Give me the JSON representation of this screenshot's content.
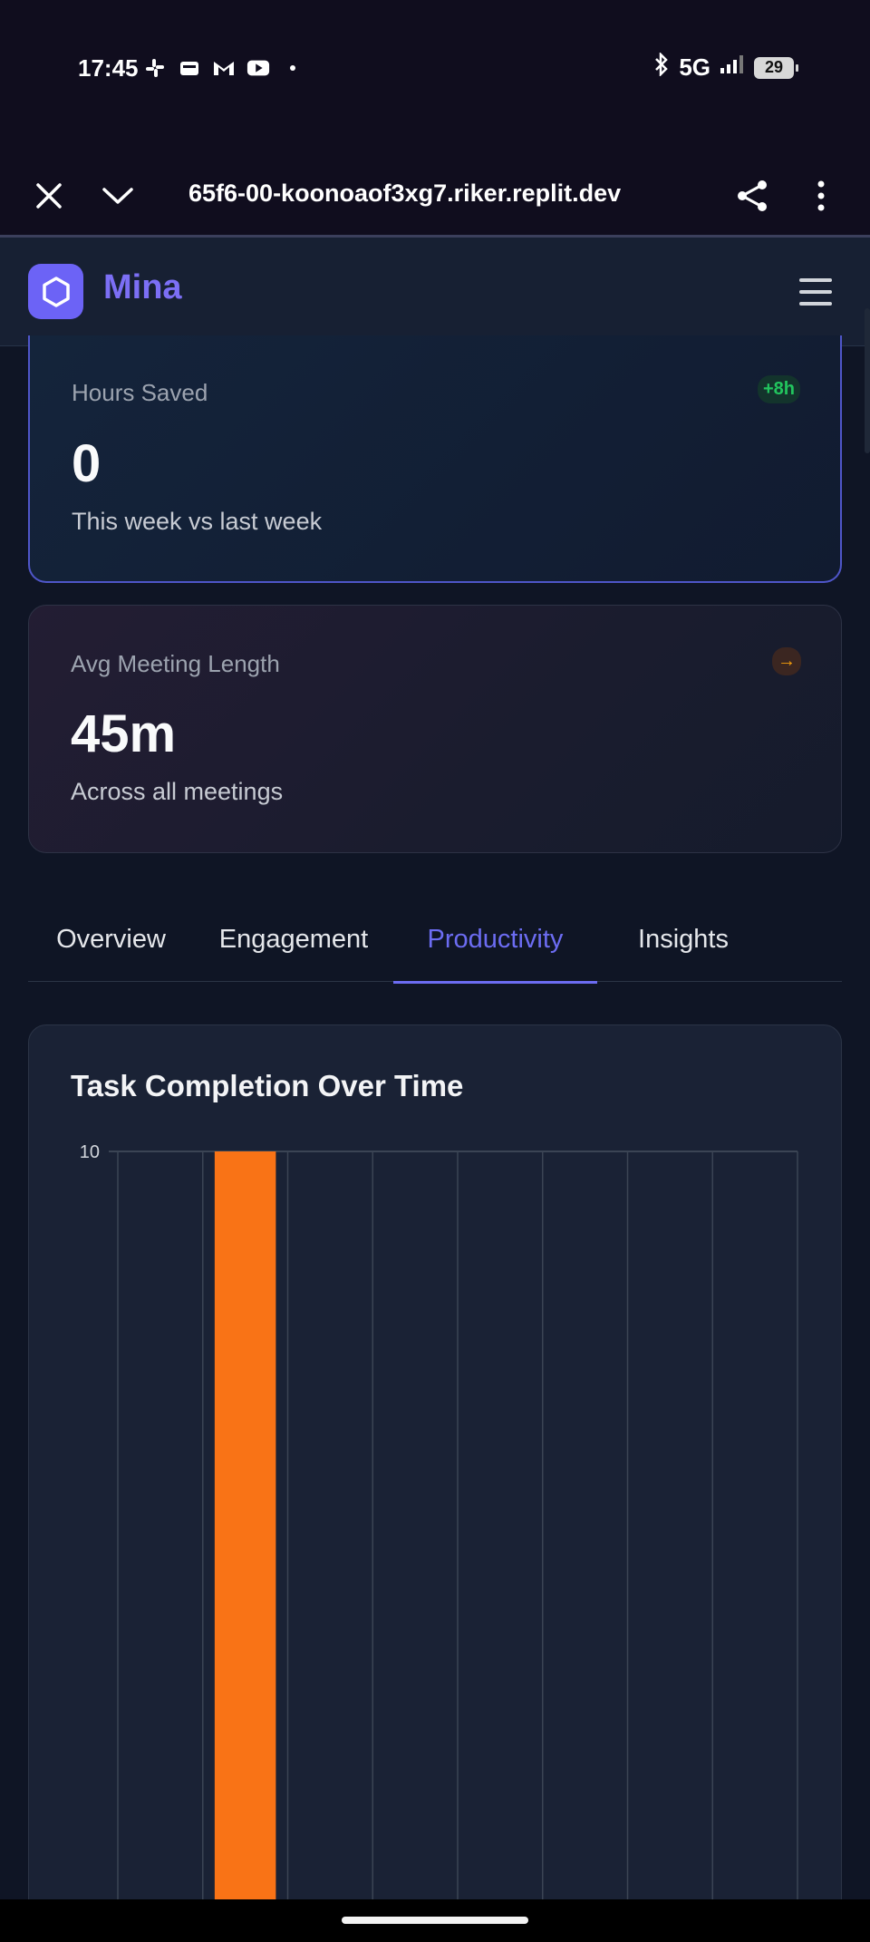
{
  "status_bar": {
    "time": "17:45",
    "network": "5G",
    "battery": "29",
    "left_icons": [
      "slack-icon",
      "wallet-icon",
      "gmail-icon",
      "youtube-icon",
      "dot-icon"
    ],
    "right_icons": [
      "bluetooth-icon",
      "signal-icon",
      "battery-icon"
    ]
  },
  "browser": {
    "url": "65f6-00-koonoaof3xg7.riker.replit.dev",
    "icons": [
      "close-icon",
      "chevron-down-icon",
      "share-icon",
      "more-vertical-icon"
    ]
  },
  "header": {
    "brand": "Mina",
    "logo_icon": "hexagon-icon",
    "menu_icon": "hamburger-menu-icon"
  },
  "cards": {
    "hours_saved": {
      "label": "Hours Saved",
      "value": "0",
      "subtitle": "This week vs last week",
      "badge": "+8h"
    },
    "avg_meeting": {
      "label": "Avg Meeting Length",
      "value": "45m",
      "subtitle": "Across all meetings",
      "badge": "→"
    }
  },
  "tabs": [
    {
      "label": "Overview",
      "active": false
    },
    {
      "label": "Engagement",
      "active": false
    },
    {
      "label": "Productivity",
      "active": true
    },
    {
      "label": "Insights",
      "active": false
    }
  ],
  "chart_data": {
    "type": "bar",
    "title": "Task Completion Over Time",
    "categories": [
      "",
      "",
      "",
      "",
      "",
      "",
      "",
      ""
    ],
    "values": [
      0,
      10,
      0,
      0,
      0,
      0,
      0,
      0
    ],
    "y_tick_labels": [
      "10"
    ],
    "ylim": [
      0,
      10
    ],
    "grid": true,
    "colors": {
      "bar": "#f97316",
      "grid": "#3b4454",
      "accent": "#6c6cf2"
    }
  }
}
